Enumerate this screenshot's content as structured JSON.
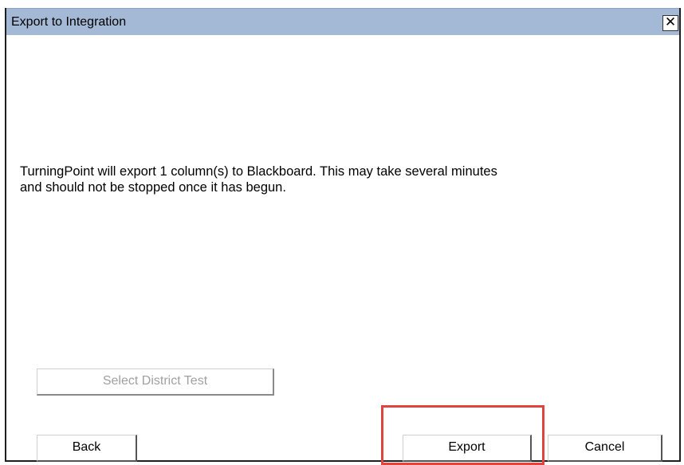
{
  "dialog": {
    "title": "Export to Integration",
    "close_glyph": "✕",
    "message_line1": "TurningPoint will export 1 column(s) to Blackboard. This may take several minutes",
    "message_line2": "and should not be stopped once it has begun.",
    "buttons": {
      "select_district_test": "Select District Test",
      "back": "Back",
      "export": "Export",
      "cancel": "Cancel"
    }
  },
  "colors": {
    "titlebar": "#a3b9d6",
    "highlight": "#e0443e",
    "disabled_text": "#a0a0a0"
  },
  "icons": {
    "close": "close-icon"
  },
  "state": {
    "select_district_test_enabled": false,
    "highlighted_button": "export"
  }
}
